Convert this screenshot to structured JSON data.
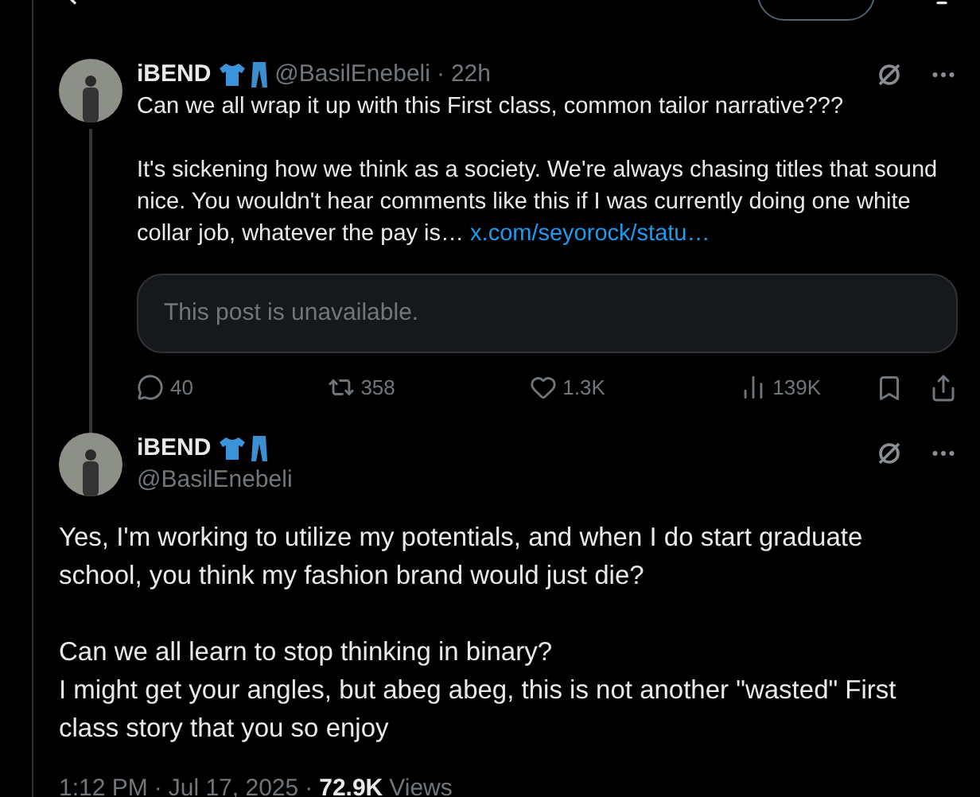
{
  "separator": "·",
  "parent_post": {
    "name": "iBEND",
    "handle": "@BasilEnebeli",
    "time": "22h",
    "paragraphs": [
      "Can we all wrap it up with this First class, common tailor narrative???",
      "It's sickening how we think as a society. We're always chasing titles that sound nice. You wouldn't hear comments like this if I was currently doing one white collar job, whatever the pay is…"
    ],
    "link": "x.com/seyorock/statu…",
    "quote": "This post is unavailable.",
    "actions": [
      {
        "kind": "reply",
        "count": "40"
      },
      {
        "kind": "repost",
        "count": "358"
      },
      {
        "kind": "like",
        "count": "1.3K"
      },
      {
        "kind": "views",
        "count": "139K"
      }
    ]
  },
  "main_post": {
    "name": "iBEND",
    "handle": "@BasilEnebeli",
    "paragraphs": [
      "Yes, I'm working to utilize my potentials, and when I do start graduate school, you think my fashion brand would just die?",
      "Can we all learn to stop thinking in binary?\nI might get your angles, but abeg abeg, this is not another \"wasted\" First class story that you so enjoy"
    ],
    "meta": {
      "time": "1:12 PM",
      "date": "Jul 17, 2025",
      "views": "72.9K",
      "views_label": "Views"
    }
  }
}
